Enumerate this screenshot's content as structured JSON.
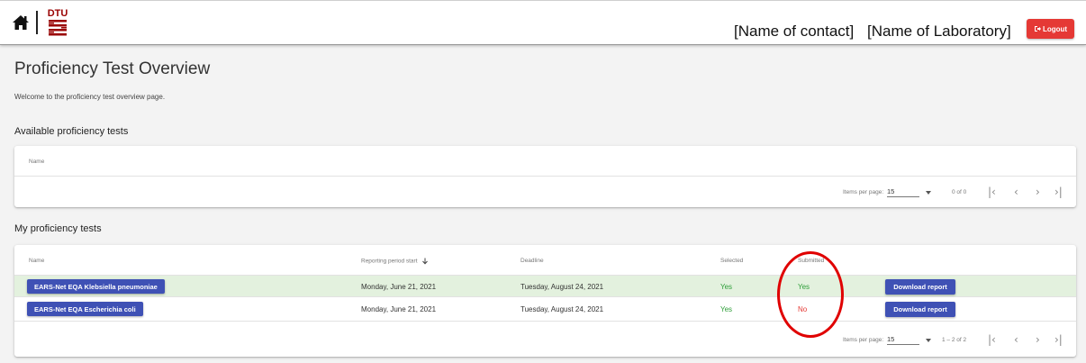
{
  "header": {
    "contact": "[Name of contact]",
    "laboratory": "[Name of Laboratory]",
    "logout_label": "Logout",
    "logo_text": "DTU",
    "brand_color": "#990000",
    "logout_color": "#e53935"
  },
  "page": {
    "title": "Proficiency Test Overview",
    "welcome": "Welcome to the proficiency test overview page."
  },
  "available": {
    "heading": "Available proficiency tests",
    "columns": {
      "name": "Name"
    },
    "paginator": {
      "items_label": "Items per page:",
      "page_size": "15",
      "range": "0 of 0"
    }
  },
  "mine": {
    "heading": "My proficiency tests",
    "columns": {
      "name": "Name",
      "reporting": "Reporting period start",
      "deadline": "Deadline",
      "selected": "Selected",
      "submitted": "Submitted"
    },
    "rows": [
      {
        "name": "EARS-Net EQA Klebsiella pneumoniae",
        "reporting": "Monday, June 21, 2021",
        "deadline": "Tuesday, August 24, 2021",
        "selected": "Yes",
        "submitted": "Yes",
        "action": "Download report"
      },
      {
        "name": "EARS-Net EQA Escherichia coli",
        "reporting": "Monday, June 21, 2021",
        "deadline": "Tuesday, August 24, 2021",
        "selected": "Yes",
        "submitted": "No",
        "action": "Download report"
      }
    ],
    "paginator": {
      "items_label": "Items per page:",
      "page_size": "15",
      "range": "1 – 2 of 2"
    }
  },
  "colors": {
    "primary": "#3f51b5",
    "yes": "#2e9e39",
    "no": "#e53935",
    "highlight_row": "#e3f1de",
    "annotation": "#e00000"
  }
}
